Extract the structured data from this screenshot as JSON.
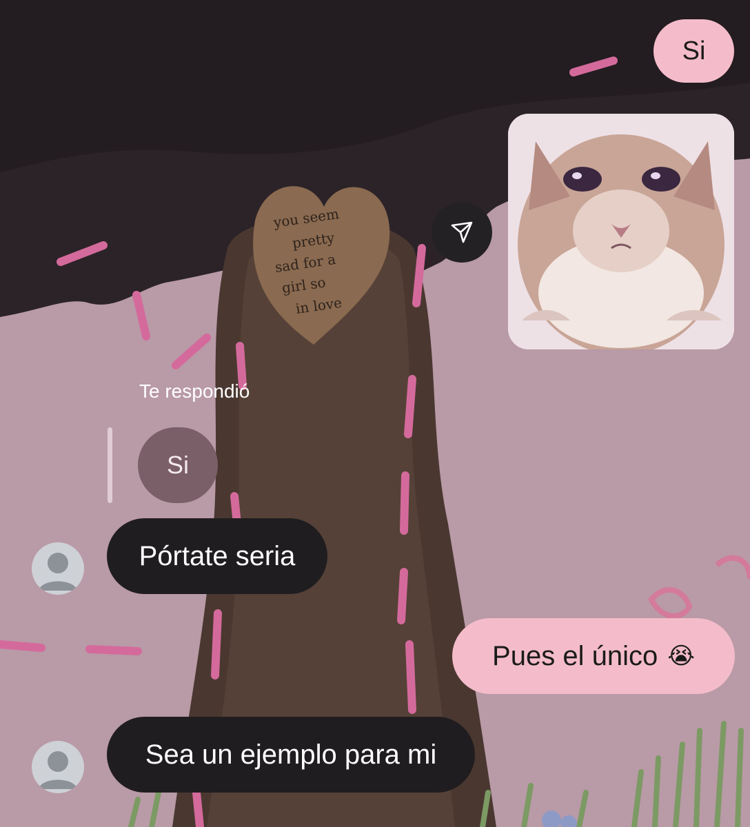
{
  "conversation": {
    "messages": [
      {
        "sender": "me",
        "text": "Si"
      },
      {
        "sender": "me",
        "type": "image",
        "content": "crying-cat-sticker"
      },
      {
        "sender": "them",
        "reply_label": "Te respondió",
        "quoted": "Si",
        "text": "Pórtate seria"
      },
      {
        "sender": "me",
        "text": "Pues el único",
        "emoji": "😭"
      },
      {
        "sender": "them",
        "text": "Sea un ejemplo para mi"
      }
    ]
  },
  "background_text": "you seem pretty sad for a girl so in love",
  "icons": {
    "share": "paper-plane-icon",
    "avatar": "default-avatar-icon"
  },
  "colors": {
    "outgoing_bubble": "#f4bcca",
    "incoming_bubble": "#201d20",
    "quoted_bubble": "#7a5e68",
    "background_pink": "#b98f9f"
  }
}
